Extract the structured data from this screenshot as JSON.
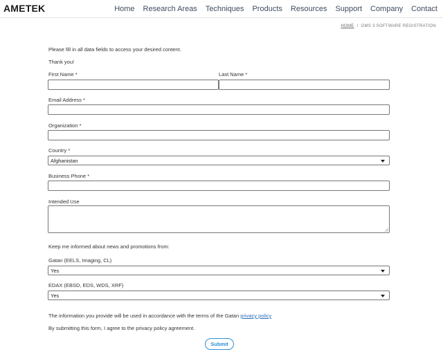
{
  "header": {
    "logo": "AMETEK",
    "nav": [
      "Home",
      "Research Areas",
      "Techniques",
      "Products",
      "Resources",
      "Support",
      "Company",
      "Contact"
    ]
  },
  "breadcrumb": {
    "home": "HOME",
    "separator": "/",
    "current": "GMS 3 SOFTWARE REGISTRATION"
  },
  "form": {
    "intro": "Please fill in all data fields to access your desired content.",
    "thanks": "Thank you!",
    "first_name": {
      "label": "First Name *",
      "value": ""
    },
    "last_name": {
      "label": "Last Name *",
      "value": ""
    },
    "email": {
      "label": "Email Address *",
      "value": ""
    },
    "organization": {
      "label": "Organization *",
      "value": ""
    },
    "country": {
      "label": "Country *",
      "value": "Afghanistan"
    },
    "business_phone": {
      "label": "Business Phone *",
      "value": ""
    },
    "intended_use": {
      "label": "Intended Use",
      "value": ""
    },
    "news_heading": "Keep me informed about news and promotions from:",
    "gatan": {
      "label": "Gatan (EELS, Imaging, CL)",
      "value": "Yes"
    },
    "edax": {
      "label": "EDAX (EBSD, EDS, WDS, XRF)",
      "value": "Yes"
    },
    "privacy_text": "The information you provide will be used in accordance with the terms of the Gatan",
    "privacy_link": "privacy policy",
    "agreement": "By submitting this form, I agree to the privacy policy agreement.",
    "submit": "Submit"
  }
}
